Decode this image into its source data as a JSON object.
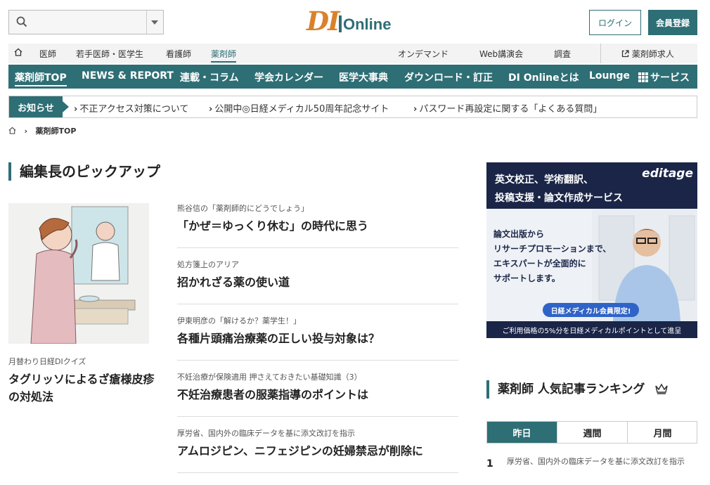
{
  "header": {
    "logo_di": "DI",
    "logo_online": "Online",
    "login_label": "ログイン",
    "register_label": "会員登録"
  },
  "subnav": {
    "left": [
      "医師",
      "若手医師・医学生",
      "看護師",
      "薬剤師"
    ],
    "right": [
      "オンデマンド",
      "Web講演会",
      "調査"
    ],
    "job": "薬剤師求人"
  },
  "mainnav": [
    "薬剤師TOP",
    "NEWS & REPORT",
    "連載・コラム",
    "学会カレンダー",
    "医学大事典",
    "ダウンロード・訂正",
    "DI Onlineとは",
    "Lounge",
    "サービス"
  ],
  "notice": {
    "label": "お知らせ",
    "items": [
      "不正アクセス対策について",
      "公開中◎日経メディカル50周年記念サイト",
      "パスワード再設定に関する「よくある質問」"
    ]
  },
  "breadcrumb": {
    "current": "薬剤師TOP"
  },
  "pickup": {
    "heading": "編集長のピックアップ",
    "feature": {
      "category": "月替わり日経DIクイズ",
      "title": "タグリッソによるざ瘡様皮疹の対処法"
    },
    "articles": [
      {
        "category": "熊谷信の「薬剤師的にどうでしょう」",
        "title": "「かぜ＝ゆっくり休む」の時代に思う"
      },
      {
        "category": "処方箋上のアリア",
        "title": "招かれざる薬の使い道"
      },
      {
        "category": "伊東明彦の「解けるか？薬学生！」",
        "title": "各種片頭痛治療薬の正しい投与対象は？"
      },
      {
        "category": "不妊治療が保険適用 押さえておきたい基礎知識（3）",
        "title": "不妊治療患者の服薬指導のポイントは"
      },
      {
        "category": "厚労省、国内外の臨床データを基に添文改訂を指示",
        "title": "アムロジピン、ニフェジピンの妊婦禁忌が削除に"
      }
    ]
  },
  "ad": {
    "line1": "英文校正、学術翻訳、",
    "line2": "投稿支援・論文作成サービス",
    "brand": "editage",
    "body": [
      "論文出版から",
      "リサーチプロモーションまで、",
      "エキスパートが全面的に",
      "サポートします。"
    ],
    "pill": "日経メディカル会員限定!",
    "footer": "ご利用価格の5%分を日経メディカルポイントとして進呈"
  },
  "ranking": {
    "heading": "薬剤師 人気記事ランキング",
    "tabs": [
      "昨日",
      "週間",
      "月間"
    ],
    "items": [
      {
        "rank": "1",
        "text": "厚労省、国内外の臨床データを基に添文改訂を指示"
      }
    ]
  },
  "colors": {
    "brand": "#2e6e75",
    "logo_accent": "#d9822b",
    "ad_navy": "#1a2547"
  }
}
